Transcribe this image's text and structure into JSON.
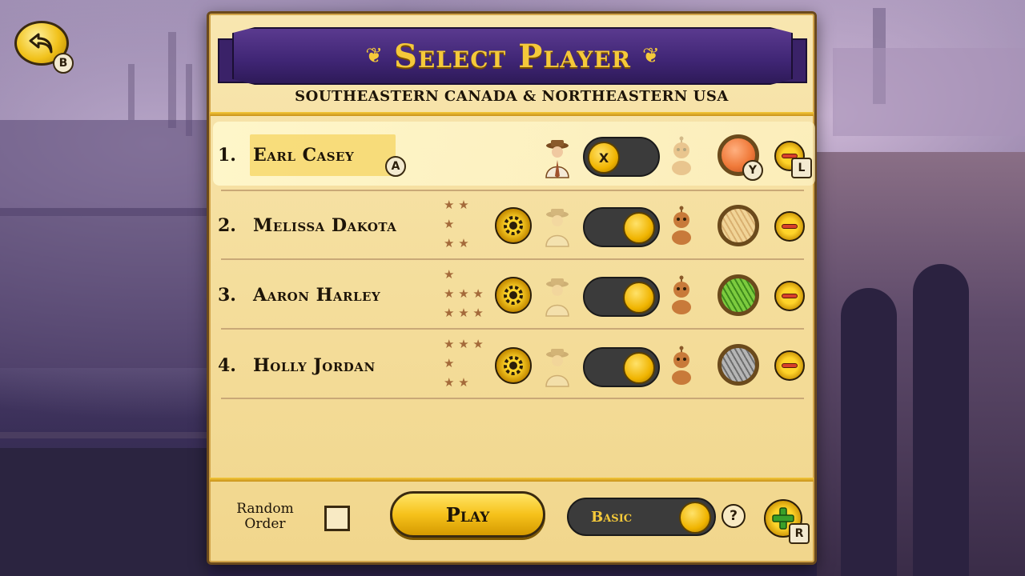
{
  "header": {
    "title": "Select Player",
    "subtitle": "SOUTHEASTERN CANADA & NORTHEASTERN USA"
  },
  "back": {
    "hint": "B"
  },
  "players": [
    {
      "number": "1.",
      "name": "Earl Casey",
      "name_hint": "A",
      "type": "human",
      "skill_stars": 0,
      "toggle_hint": "X",
      "color_name": "orange",
      "color": "#f07a3a",
      "color_hint": "Y",
      "remove_hint": "L",
      "selected": true
    },
    {
      "number": "2.",
      "name": "Melissa Dakota",
      "type": "ai",
      "skill_stars": 5,
      "star_rows": [
        "★ ★",
        "★",
        "★ ★"
      ],
      "color_name": "wood",
      "color": "#e9c98a",
      "selected": false
    },
    {
      "number": "3.",
      "name": "Aaron Harley",
      "type": "ai",
      "skill_stars": 7,
      "star_rows": [
        "★",
        "★ ★ ★",
        "★ ★ ★"
      ],
      "color_name": "green",
      "color": "#5fae2e",
      "selected": false
    },
    {
      "number": "4.",
      "name": "Holly Jordan",
      "type": "ai",
      "skill_stars": 6,
      "star_rows": [
        "★ ★ ★",
        "★",
        "★ ★"
      ],
      "color_name": "gray",
      "color": "#8d8d8d",
      "selected": false
    }
  ],
  "footer": {
    "random_order_label": "Random Order",
    "random_order_checked": false,
    "play_label": "Play",
    "mode_label": "Basic",
    "help_label": "?",
    "add_hint": "R"
  },
  "colors": {
    "accent_gold": "#f5c93a",
    "banner_purple": "#3f2574",
    "parchment": "#f5df9f"
  },
  "icons": {
    "back": "back-arrow-icon",
    "settings": "gear-icon",
    "human": "human-player-icon",
    "ai": "robot-icon",
    "remove": "minus-icon",
    "add": "plus-icon",
    "help": "question-icon"
  }
}
